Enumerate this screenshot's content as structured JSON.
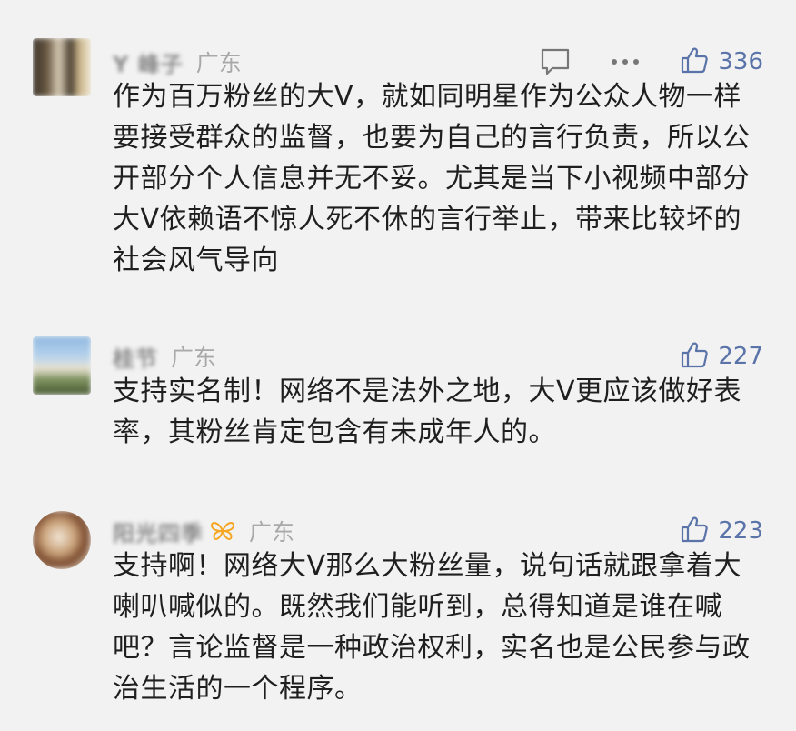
{
  "comments": [
    {
      "username": "Y 峰子",
      "location": "广东",
      "likes": "336",
      "text": "作为百万粉丝的大V，就如同明星作为公众人物一样要接受群众的监督，也要为自己的言行负责，所以公开部分个人信息并无不妥。尤其是当下小视频中部分大V依赖语不惊人死不休的言行举止，带来比较坏的社会风气导向"
    },
    {
      "username": "桂节",
      "location": "广东",
      "likes": "227",
      "text": "支持实名制！网络不是法外之地，大V更应该做好表率，其粉丝肯定包含有未成年人的。"
    },
    {
      "username": "阳光四季",
      "location": "广东",
      "likes": "223",
      "text": "支持啊！网络大V那么大粉丝量，说句话就跟拿着大喇叭喊似的。既然我们能听到，总得知道是谁在喊吧？言论监督是一种政治权利，实名也是公民参与政治生活的一个程序。"
    }
  ],
  "colors": {
    "background": "#f2f2f2",
    "like_blue": "#5a73a8",
    "vip_orange": "#f5a623"
  },
  "icons": {
    "reply": "comment-bubble-icon",
    "more": "more-dots-icon",
    "like": "thumbs-up-icon",
    "vip": "butterfly-vip-icon"
  }
}
